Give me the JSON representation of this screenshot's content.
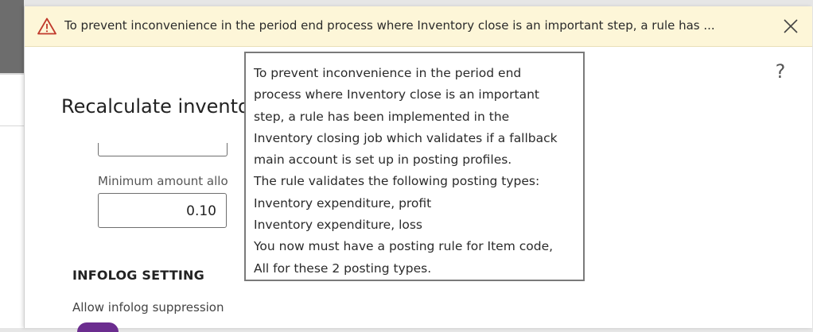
{
  "message_bar": {
    "text": "To prevent inconvenience in the period end process where Inventory close is an important step, a rule has ...",
    "warning_icon": "warning-triangle-icon",
    "close_icon": "close-icon"
  },
  "help": {
    "glyph": "?",
    "icon": "help-icon"
  },
  "dialog": {
    "title": "Recalculate invento",
    "min_amount_label": "Minimum amount allo",
    "min_amount_value": "0.10",
    "infolog_heading": "INFOLOG SETTING",
    "allow_infolog_label": "Allow infolog suppression"
  },
  "tooltip": {
    "lines": [
      "To prevent inconvenience in the period end",
      "process where Inventory close is an important",
      "step, a rule has been implemented in the",
      "Inventory closing job which validates if a fallback",
      "main account is set up in posting profiles.",
      "The rule validates the following posting types:",
      "Inventory expenditure, profit",
      "Inventory expenditure, loss",
      "You now must have a posting rule for Item code,",
      "All for these 2 posting types."
    ]
  },
  "colors": {
    "message_bar_bg": "#fdf6d8",
    "warning_icon": "#c0392b",
    "toggle_accent": "#6b2d8f"
  }
}
